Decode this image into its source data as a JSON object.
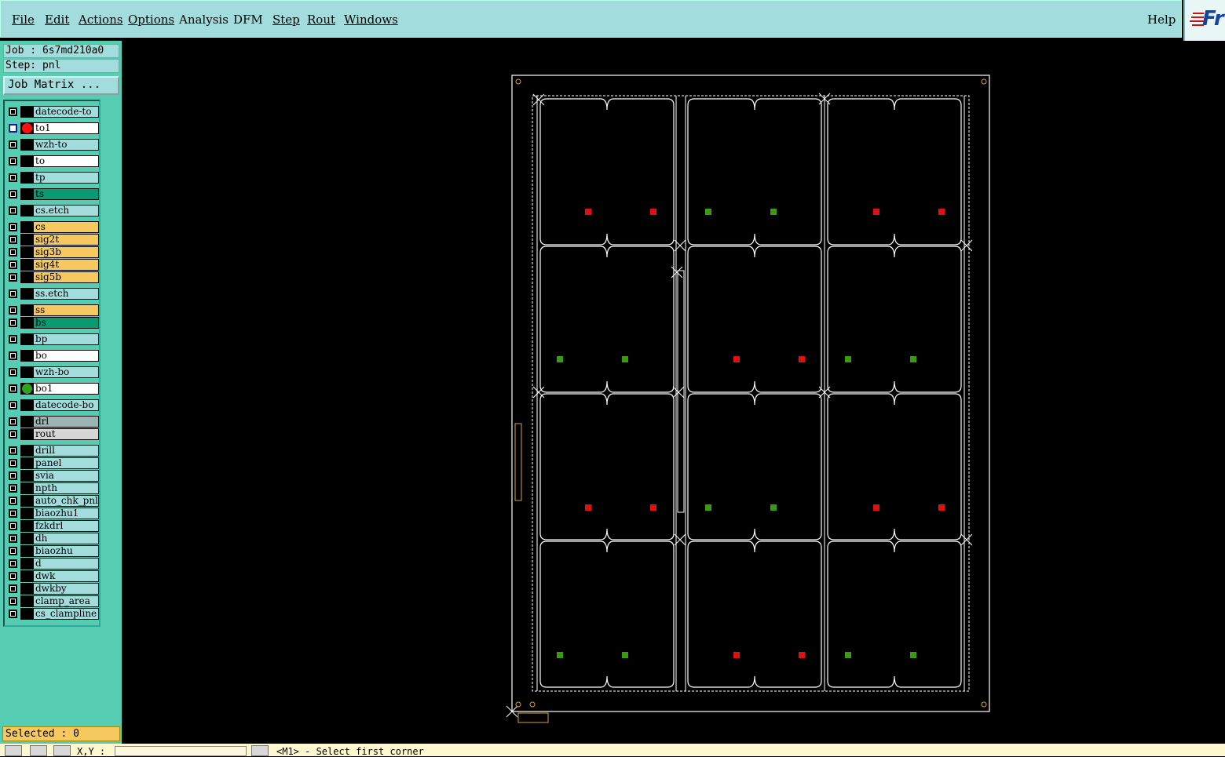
{
  "menu": {
    "file": "File",
    "edit": "Edit",
    "actions": "Actions",
    "options": "Options",
    "analysis": "Analysis",
    "dfm": "DFM",
    "step": "Step",
    "rout": "Rout",
    "windows": "Windows",
    "help": "Help"
  },
  "logo_text": "Fr",
  "job_label": "Job : 6s7md210a0",
  "step_label": "Step: pnl",
  "job_matrix_label": "Job Matrix ...",
  "layers": [
    {
      "name": "datecode-to",
      "color": "#a3dcdc"
    },
    {
      "name": "to1",
      "color": "#ffffff",
      "marker": "red-dot",
      "active": true
    },
    {
      "name": "wzh-to",
      "color": "#a3dcdc"
    },
    {
      "name": "to",
      "color": "#ffffff"
    },
    {
      "name": "tp",
      "color": "#a3dcdc"
    },
    {
      "name": "ts",
      "color": "#0a9a72"
    },
    {
      "name": "cs.etch",
      "color": "#a3dcdc"
    },
    {
      "name": "cs",
      "color": "#f6c860"
    },
    {
      "name": "sig2t",
      "color": "#f6c860"
    },
    {
      "name": "sig3b",
      "color": "#f6c860"
    },
    {
      "name": "sig4t",
      "color": "#f6c860"
    },
    {
      "name": "sig5b",
      "color": "#f6c860"
    },
    {
      "name": "ss.etch",
      "color": "#a3dcdc"
    },
    {
      "name": "ss",
      "color": "#f6c860"
    },
    {
      "name": "bs",
      "color": "#0a9a72"
    },
    {
      "name": "bp",
      "color": "#a3dcdc"
    },
    {
      "name": "bo",
      "color": "#ffffff"
    },
    {
      "name": "wzh-bo",
      "color": "#a3dcdc"
    },
    {
      "name": "bo1",
      "color": "#ffffff",
      "marker": "green-dot"
    },
    {
      "name": "datecode-bo",
      "color": "#a3dcdc"
    },
    {
      "name": "drl",
      "color": "#9bb4b4"
    },
    {
      "name": "rout",
      "color": "#d6d6d6"
    },
    {
      "name": "drill",
      "color": "#a3dcdc"
    },
    {
      "name": "panel",
      "color": "#a3dcdc"
    },
    {
      "name": "svia",
      "color": "#a3dcdc"
    },
    {
      "name": "npth",
      "color": "#a3dcdc"
    },
    {
      "name": "auto_chk_pnl",
      "color": "#a3dcdc"
    },
    {
      "name": "biaozhu1",
      "color": "#a3dcdc"
    },
    {
      "name": "fzkdrl",
      "color": "#a3dcdc"
    },
    {
      "name": "dh",
      "color": "#a3dcdc"
    },
    {
      "name": "biaozhu",
      "color": "#a3dcdc"
    },
    {
      "name": "d",
      "color": "#a3dcdc"
    },
    {
      "name": "dwk",
      "color": "#a3dcdc"
    },
    {
      "name": "dwkby",
      "color": "#a3dcdc"
    },
    {
      "name": "clamp_area",
      "color": "#a3dcdc"
    },
    {
      "name": "cs_clampline",
      "color": "#a3dcdc"
    }
  ],
  "selected_label": "Selected : 0",
  "coord_label": "X,Y :",
  "coord_value": "",
  "status_message": "<M1> - Select first corner",
  "colors": {
    "pad_red": "#e01010",
    "pad_green": "#3c9a10",
    "outline": "#ffffff",
    "background": "#000000"
  },
  "icons": [
    "zoom-icon",
    "check-icon",
    "grid-icon",
    "plus-icon"
  ]
}
